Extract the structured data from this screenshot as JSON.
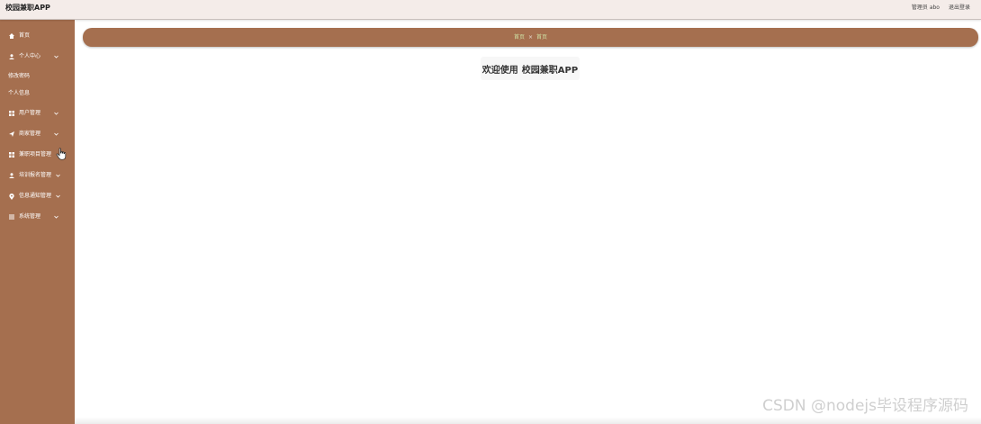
{
  "header": {
    "app_title": "校园兼职APP",
    "user_label": "管理员 abo",
    "logout_label": "退出登录"
  },
  "sidebar": {
    "items": [
      {
        "label": "首页",
        "icon": "home-icon"
      },
      {
        "label": "个人中心",
        "icon": "user-icon",
        "expanded": true
      },
      {
        "label": "用户管理",
        "icon": "grid-icon"
      },
      {
        "label": "商家管理",
        "icon": "send-icon"
      },
      {
        "label": "兼职项目管理",
        "icon": "grid-icon"
      },
      {
        "label": "培训报名管理",
        "icon": "user-icon"
      },
      {
        "label": "信息通知管理",
        "icon": "location-icon"
      },
      {
        "label": "系统管理",
        "icon": "list-icon"
      }
    ],
    "subitems": [
      {
        "label": "修改密码"
      },
      {
        "label": "个人信息"
      }
    ]
  },
  "breadcrumb": {
    "items": [
      "首页",
      "首页"
    ],
    "separator": "×"
  },
  "main": {
    "welcome_prefix": "欢迎使用",
    "welcome_app": "校园兼职APP"
  },
  "watermark": "CSDN @nodejs毕设程序源码",
  "colors": {
    "header_bg": "#f4ece9",
    "sidebar_bg": "#a56f4f",
    "breadcrumb_bg": "#a56f4f",
    "breadcrumb_text": "#cfe3a7"
  }
}
